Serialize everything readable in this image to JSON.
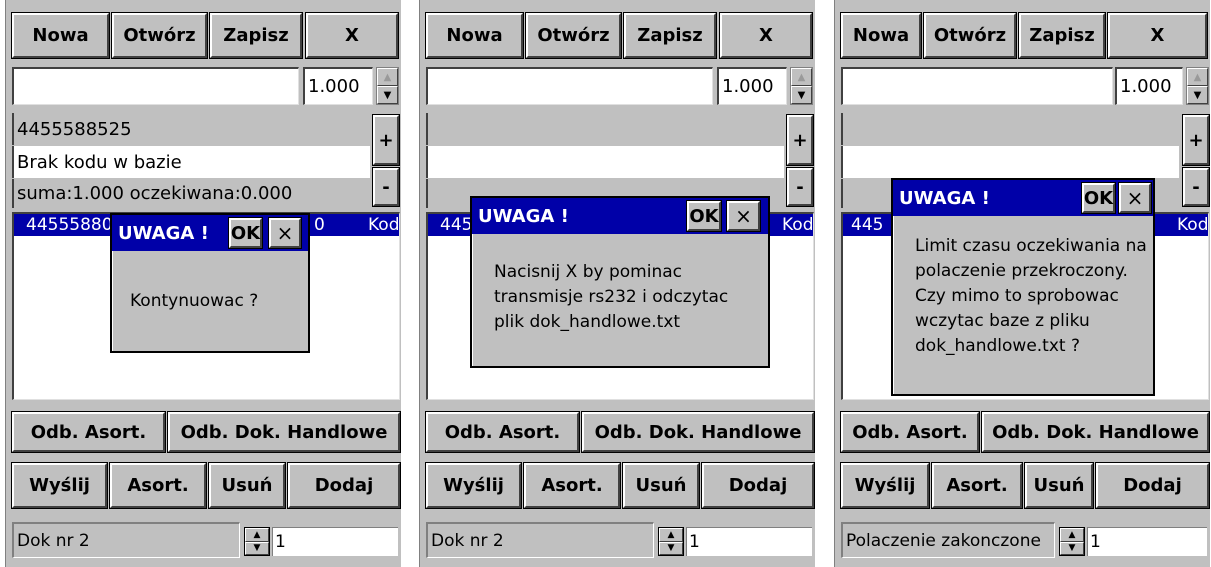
{
  "screens": [
    {
      "toolbar": {
        "new": "Nowa",
        "open": "Otwórz",
        "save": "Zapisz",
        "close": "X"
      },
      "quantity": "1.000",
      "plus": "+",
      "minus": "-",
      "code_row": "4455588525",
      "name_row": "Brak kodu w bazie",
      "sum_row": "suma:1.000 oczekiwana:0.000",
      "list_cells": [
        "44555880",
        "0",
        "Kod"
      ],
      "buttons": {
        "odb_asort": "Odb. Asort.",
        "odb_dok": "Odb. Dok. Handlowe",
        "send": "Wyślij",
        "asort": "Asort.",
        "delete": "Usuń",
        "add": "Dodaj"
      },
      "status": "Dok nr 2",
      "page": "1",
      "dialog": {
        "title": "UWAGA !",
        "ok": "OK",
        "close": "×",
        "lines": [
          "Kontynuowac ?"
        ]
      }
    },
    {
      "toolbar": {
        "new": "Nowa",
        "open": "Otwórz",
        "save": "Zapisz",
        "close": "X"
      },
      "quantity": "1.000",
      "plus": "+",
      "minus": "-",
      "code_row": "",
      "name_row": "",
      "sum_row": "",
      "list_cells": [
        "445",
        "",
        "Kod"
      ],
      "buttons": {
        "odb_asort": "Odb. Asort.",
        "odb_dok": "Odb. Dok. Handlowe",
        "send": "Wyślij",
        "asort": "Asort.",
        "delete": "Usuń",
        "add": "Dodaj"
      },
      "status": "Dok nr 2",
      "page": "1",
      "dialog": {
        "title": "UWAGA !",
        "ok": "OK",
        "close": "×",
        "lines": [
          "Nacisnij X by pominac",
          "transmisje rs232 i odczytac",
          "plik dok_handlowe.txt"
        ]
      }
    },
    {
      "toolbar": {
        "new": "Nowa",
        "open": "Otwórz",
        "save": "Zapisz",
        "close": "X"
      },
      "quantity": "1.000",
      "plus": "+",
      "minus": "-",
      "code_row": "",
      "name_row": "",
      "sum_row": "",
      "list_cells": [
        "445",
        "",
        "Kod"
      ],
      "buttons": {
        "odb_asort": "Odb. Asort.",
        "odb_dok": "Odb. Dok. Handlowe",
        "send": "Wyślij",
        "asort": "Asort.",
        "delete": "Usuń",
        "add": "Dodaj"
      },
      "status": "Polaczenie zakonczone",
      "page": "1",
      "dialog": {
        "title": "UWAGA !",
        "ok": "OK",
        "close": "×",
        "lines": [
          "Limit czasu oczekiwania na",
          "polaczenie przekroczony.",
          "Czy mimo to sprobowac",
          "wczytac baze z pliku",
          "dok_handlowe.txt ?"
        ]
      }
    }
  ]
}
